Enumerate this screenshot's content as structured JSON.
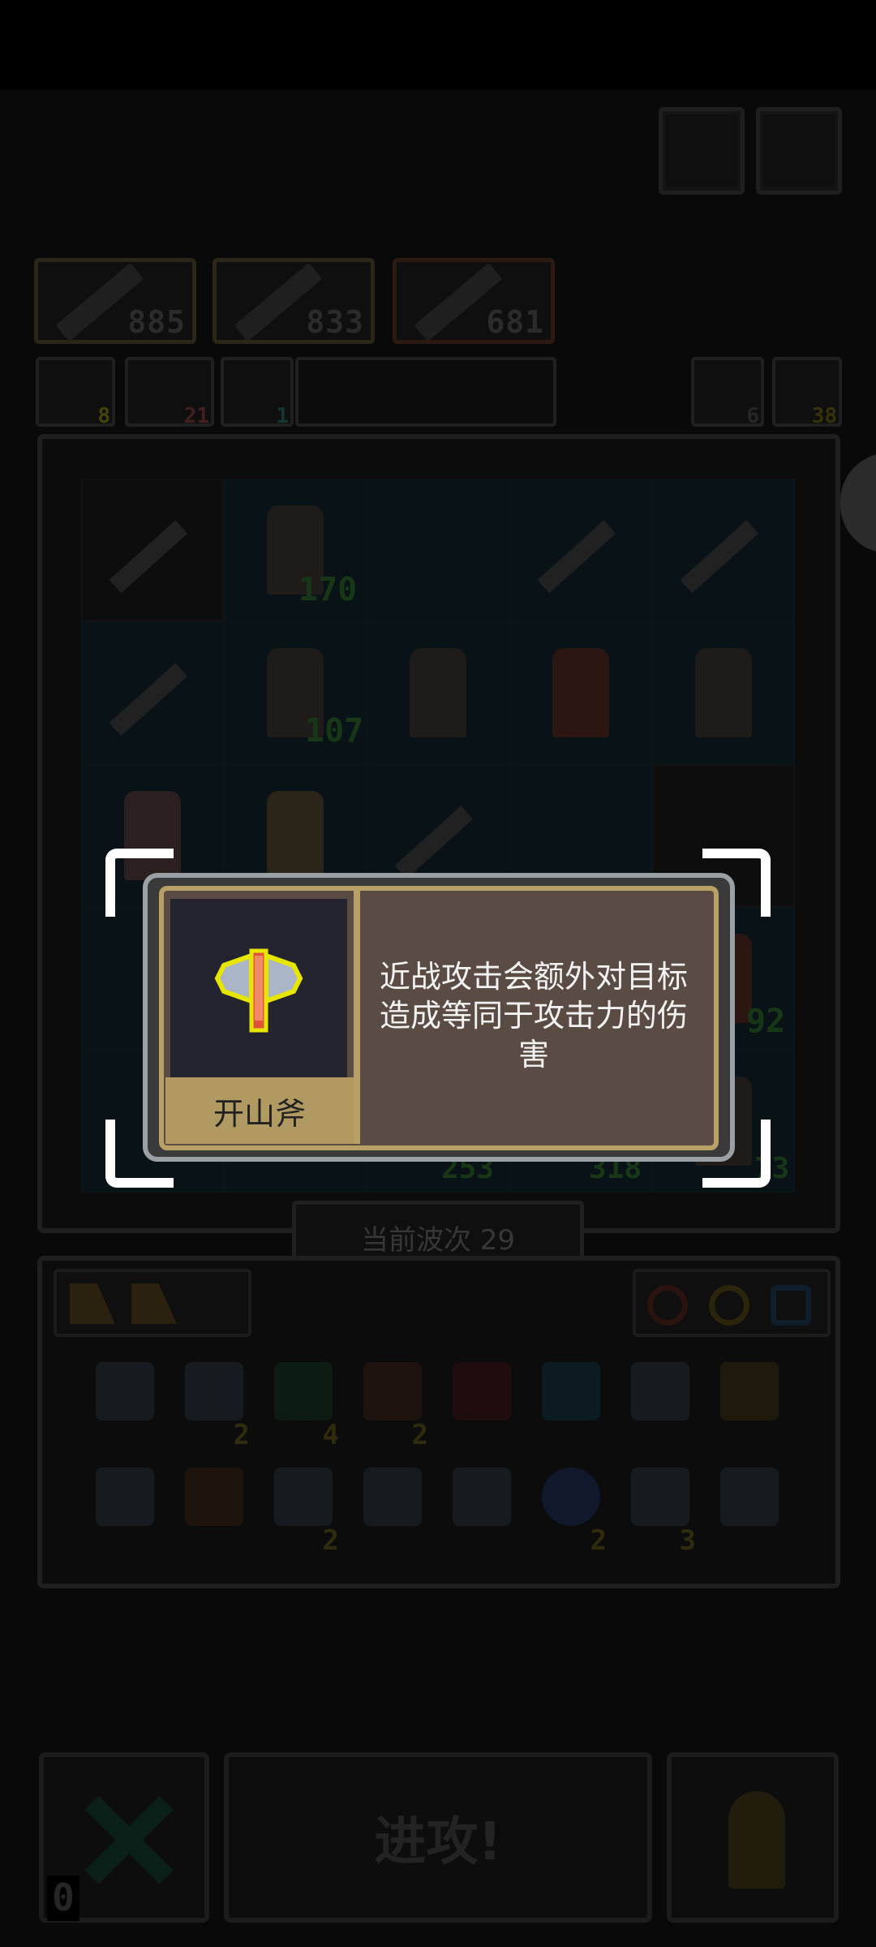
{
  "weapons": [
    {
      "value": "885"
    },
    {
      "value": "833"
    },
    {
      "value": "681"
    }
  ],
  "resources_left": [
    {
      "icon": "gold-coin-icon",
      "count": "8",
      "color": "#5a5a10"
    },
    {
      "icon": "star-icon",
      "count": "21",
      "color": "#5a2a2a"
    },
    {
      "icon": "target-icon",
      "count": "1",
      "color": "#1a4a4a"
    }
  ],
  "resources_right": [
    {
      "icon": "refresh-icon",
      "count": "6"
    },
    {
      "icon": "key-icon",
      "count": "38"
    }
  ],
  "board": {
    "cells": [
      [
        "sword",
        "hero",
        "empty",
        "sword",
        "sword"
      ],
      [
        "sword",
        "hero",
        "hero",
        "hero",
        "hero"
      ],
      [
        "hero",
        "hero",
        "sword",
        "empty",
        "dark"
      ],
      [
        "empty",
        "empty",
        "empty",
        "empty",
        "hero"
      ],
      [
        "empty",
        "empty",
        "empty",
        "empty",
        "hero"
      ]
    ],
    "hero_levels": [
      "170",
      "107",
      "92",
      "253",
      "318",
      "73"
    ]
  },
  "wave_label": "当前波次 29",
  "inventory": {
    "counts": [
      "",
      "2",
      "4",
      "2",
      "",
      "",
      "",
      "",
      "",
      "",
      "2",
      "",
      "",
      "2",
      "3",
      ""
    ]
  },
  "attack_label": "进攻!",
  "lives_count": "0",
  "tooltip": {
    "item_name": "开山斧",
    "description": "近战攻击会额外对目标造成等同于攻击力的伤害",
    "accent_color": "#b9a066"
  }
}
